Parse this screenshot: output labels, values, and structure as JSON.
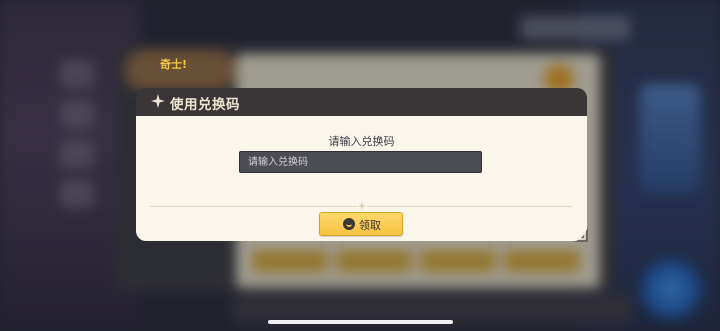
{
  "background": {
    "badge_text": "奇士!"
  },
  "dialog": {
    "title": "使用兑换码",
    "prompt": "请输入兑换码",
    "input_value": "",
    "input_placeholder": "请输入兑换码",
    "claim_label": "领取"
  },
  "colors": {
    "header": "#3a3536",
    "body": "#faf6ec",
    "button": "#f5c342",
    "input": "#4c4c55"
  }
}
